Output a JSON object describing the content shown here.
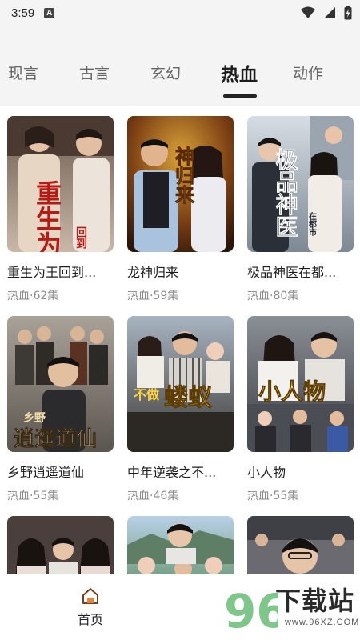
{
  "status_bar": {
    "time": "3:59",
    "notification_icon": "A"
  },
  "tabs": [
    {
      "label": "现言"
    },
    {
      "label": "古言"
    },
    {
      "label": "玄幻"
    },
    {
      "label": "热血",
      "active": true
    },
    {
      "label": "动作"
    }
  ],
  "dramas": [
    {
      "title": "重生为王回到...",
      "meta": "热血·62集",
      "poster_text": "重生为王",
      "poster_sub": "回到"
    },
    {
      "title": "龙神归来",
      "meta": "热血·59集",
      "poster_text": "神归来"
    },
    {
      "title": "极品神医在都...",
      "meta": "热血·80集",
      "poster_text": "极品神医",
      "poster_sub": "在都市"
    },
    {
      "title": "乡野逍遥道仙",
      "meta": "热血·55集",
      "poster_text": "逍遥道仙",
      "poster_sub": "乡野"
    },
    {
      "title": "中年逆袭之不...",
      "meta": "热血·46集",
      "poster_text": "蝼蚁",
      "poster_sub": "不做"
    },
    {
      "title": "小人物",
      "meta": "热血·55集",
      "poster_text": "小人物"
    },
    {
      "title": "",
      "meta": ""
    },
    {
      "title": "",
      "meta": ""
    },
    {
      "title": "",
      "meta": ""
    }
  ],
  "bottom_nav": {
    "home_label": "首页",
    "home_icon": "home-icon"
  },
  "watermark": {
    "logo": "96",
    "text": "下载站",
    "url": "www.96XZ.COM"
  }
}
